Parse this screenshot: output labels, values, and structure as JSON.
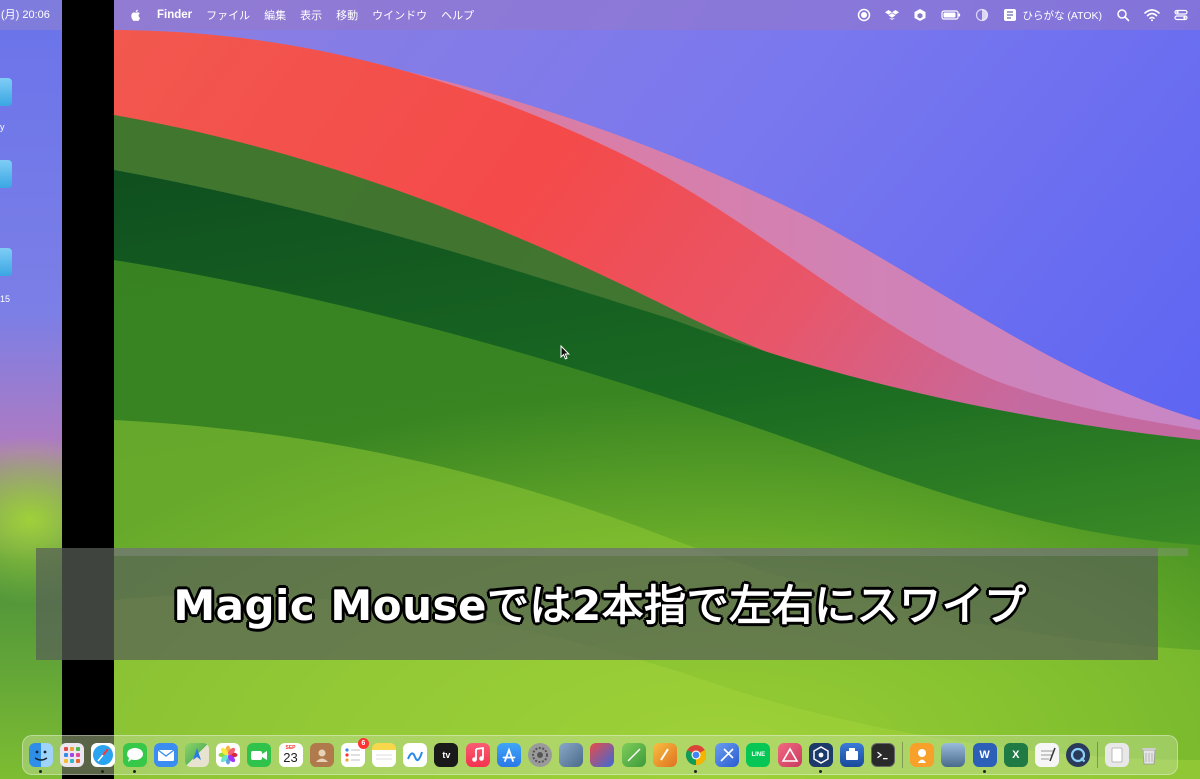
{
  "left_space": {
    "clock_fragment": "(月) 20:06",
    "label_1": "y",
    "label_2": "15"
  },
  "menubar": {
    "app_name": "Finder",
    "menus": [
      "ファイル",
      "編集",
      "表示",
      "移動",
      "ウインドウ",
      "ヘルプ"
    ],
    "input_method": "ひらがな (ATOK)"
  },
  "caption": {
    "text": "Magic Mouseでは2本指で左右にスワイプ"
  },
  "dock": {
    "calendar_month": "SEP",
    "calendar_day": "23",
    "reminders_badge": "6",
    "apps": [
      {
        "name": "finder",
        "color": "#2f8fe8"
      },
      {
        "name": "launchpad",
        "color": "#e9e4ef"
      },
      {
        "name": "safari",
        "color": "#2aa3f0"
      },
      {
        "name": "messages",
        "color": "#37c84a"
      },
      {
        "name": "mail",
        "color": "#3b8df2"
      },
      {
        "name": "maps",
        "color": "#5fb85a"
      },
      {
        "name": "photos",
        "color": "#f4f4f4"
      },
      {
        "name": "facetime",
        "color": "#2fc34b"
      },
      {
        "name": "calendar",
        "color": "#ffffff"
      },
      {
        "name": "contacts",
        "color": "#a7744a"
      },
      {
        "name": "reminders",
        "color": "#ffffff"
      },
      {
        "name": "notes",
        "color": "#f8d74a"
      },
      {
        "name": "freeform",
        "color": "#ffffff"
      },
      {
        "name": "tv",
        "color": "#1a1a1a"
      },
      {
        "name": "music",
        "color": "#f5435b"
      },
      {
        "name": "app-store",
        "color": "#2e8ff4"
      },
      {
        "name": "system-settings",
        "color": "#8c8c8c"
      },
      {
        "name": "preview",
        "color": "#6a7a8a"
      },
      {
        "name": "photo-booth",
        "color": "#d8383d"
      },
      {
        "name": "numbers-like",
        "color": "#5bb14a"
      },
      {
        "name": "pages-like",
        "color": "#f0a030"
      },
      {
        "name": "chrome",
        "color": "#ffffff"
      },
      {
        "name": "xcode-like",
        "color": "#4a7fe0"
      },
      {
        "name": "line",
        "color": "#06c755"
      },
      {
        "name": "affinity-like",
        "color": "#e84a5f"
      },
      {
        "name": "blue-cube",
        "color": "#1c3b6a"
      },
      {
        "name": "disk-app",
        "color": "#2a5faa"
      },
      {
        "name": "terminal-like",
        "color": "#2a2a2a"
      },
      {
        "name": "mascot-app",
        "color": "#f7a12a"
      },
      {
        "name": "screen-app",
        "color": "#4a6a8a"
      },
      {
        "name": "word",
        "color": "#2b5fb8"
      },
      {
        "name": "excel",
        "color": "#1f7a44"
      },
      {
        "name": "textedit",
        "color": "#f2f2f2"
      },
      {
        "name": "quicktime",
        "color": "#2a3a5a"
      },
      {
        "name": "files",
        "color": "#e8e8e8"
      },
      {
        "name": "trash",
        "color": "#d9d9d9"
      }
    ],
    "word_label": "W",
    "excel_label": "X",
    "line_label": "LINE",
    "tv_label": "tv"
  }
}
